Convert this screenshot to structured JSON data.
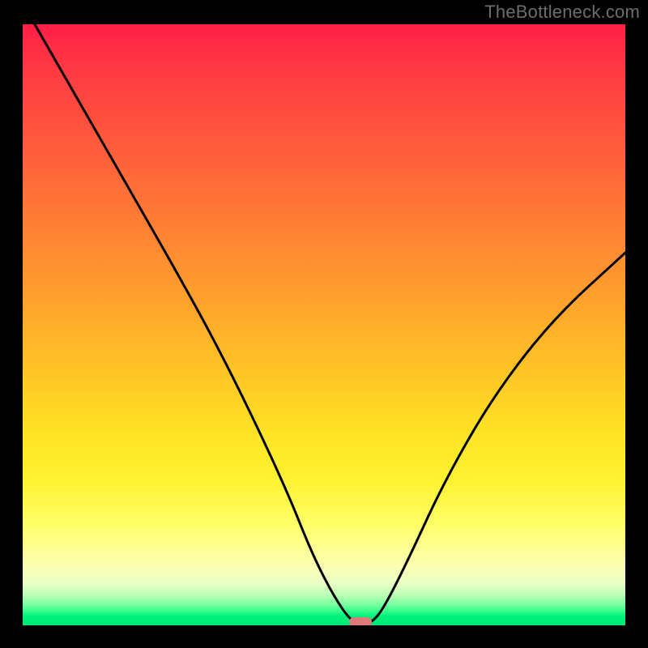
{
  "watermark": "TheBottleneck.com",
  "chart_data": {
    "type": "line",
    "title": "",
    "xlabel": "",
    "ylabel": "",
    "xlim": [
      0,
      100
    ],
    "ylim": [
      0,
      100
    ],
    "series": [
      {
        "name": "bottleneck-curve",
        "x": [
          2,
          10,
          18,
          26,
          32,
          38,
          44,
          48,
          51,
          53.5,
          55,
          56.5,
          58,
          60,
          64,
          70,
          78,
          88,
          100
        ],
        "y": [
          100,
          86,
          72,
          58,
          47,
          35,
          22,
          12,
          6,
          2,
          0.5,
          0.3,
          0.5,
          3,
          11,
          24,
          38,
          51,
          62
        ]
      }
    ],
    "marker": {
      "x": 56,
      "y": 0.5
    },
    "gradient_stops": [
      {
        "pct": 0,
        "color": "#ff1f47"
      },
      {
        "pct": 33,
        "color": "#ff7e34"
      },
      {
        "pct": 68,
        "color": "#ffe324"
      },
      {
        "pct": 90,
        "color": "#fdffb0"
      },
      {
        "pct": 100,
        "color": "#00e676"
      }
    ]
  }
}
